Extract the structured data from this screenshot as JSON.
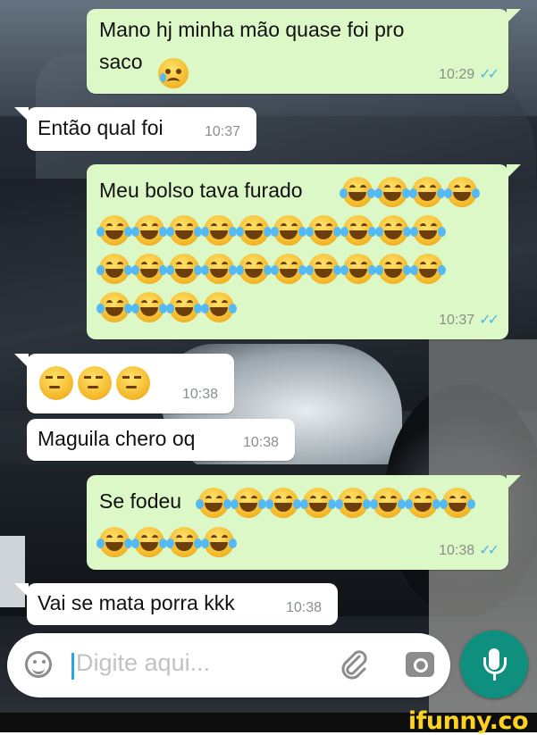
{
  "chat": {
    "messages": [
      {
        "dir": "out",
        "text": "Mano hj minha mão quase foi pro\nsaco",
        "emoji_after": [
          "cry-face"
        ],
        "time": "10:29",
        "status": "read"
      },
      {
        "dir": "in",
        "text": "Então qual foi",
        "time": "10:37"
      },
      {
        "dir": "out",
        "text": "Meu bolso tava furado",
        "emoji_after": {
          "name": "face-with-tears-of-joy",
          "count": 28
        },
        "time": "10:37",
        "status": "read"
      },
      {
        "dir": "in",
        "text": "",
        "emoji_after": {
          "name": "unamused-face",
          "count": 3
        },
        "time": "10:38"
      },
      {
        "dir": "in",
        "text": "Maguila chero oq",
        "time": "10:38"
      },
      {
        "dir": "out",
        "text": "Se fodeu",
        "emoji_after": {
          "name": "face-with-tears-of-joy",
          "count": 12
        },
        "time": "10:38",
        "status": "read"
      },
      {
        "dir": "in",
        "text": "Vai se mata porra kkk",
        "time": "10:38"
      }
    ]
  },
  "composer": {
    "placeholder": "Digite aqui...",
    "icons": [
      "emoji-icon",
      "attach-paperclip-icon",
      "camera-icon",
      "microphone-icon"
    ]
  },
  "watermark": {
    "text": "ifunny.co"
  },
  "colors": {
    "outgoing": "#dcf8c6",
    "incoming": "#ffffff",
    "read_ticks": "#4fb6ec",
    "mic_button": "#0f8f7e",
    "brand": "#ffd21f"
  }
}
